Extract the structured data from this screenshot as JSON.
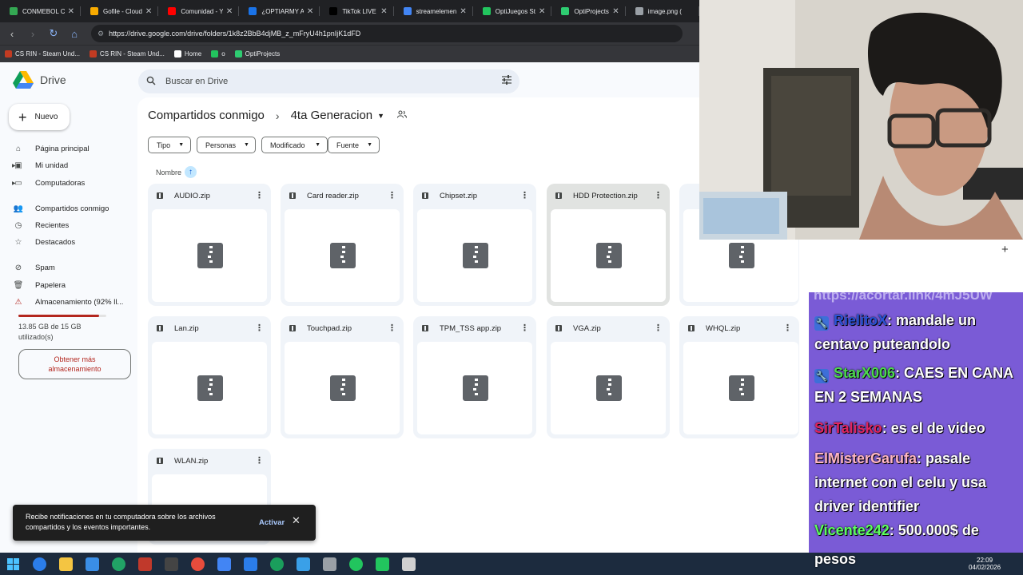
{
  "browser": {
    "tabs": [
      {
        "title": "CONMEBOL C",
        "color": "#34a853"
      },
      {
        "title": "Gofile - Cloud",
        "color": "#f9ab00"
      },
      {
        "title": "Comunidad - Y",
        "color": "#ff0000"
      },
      {
        "title": "¿OPTIARMY A",
        "color": "#1a73e8"
      },
      {
        "title": "TikTok LIVE",
        "color": "#000000"
      },
      {
        "title": "streamelemen",
        "color": "#4285f4"
      },
      {
        "title": "OptiJuegos St",
        "color": "#22c55e"
      },
      {
        "title": "OptiProjects",
        "color": "#2ecc71"
      },
      {
        "title": "image.png (",
        "color": "#9aa0a6"
      }
    ],
    "url": "https://drive.google.com/drive/folders/1k8z2BbB4djMB_z_mFryU4h1pnIjK1dFD",
    "bookmarks": [
      {
        "label": "CS RIN - Steam Und...",
        "color": "#c23b22"
      },
      {
        "label": "CS RIN - Steam Und...",
        "color": "#c23b22"
      },
      {
        "label": "Home",
        "color": "#ffffff"
      },
      {
        "label": "o",
        "color": "#22c55e"
      },
      {
        "label": "OptiProjects",
        "color": "#2ecc71"
      }
    ]
  },
  "drive": {
    "app_name": "Drive",
    "search_placeholder": "Buscar en Drive",
    "new_label": "Nuevo",
    "nav": [
      {
        "label": "Página principal",
        "icon": "home-icon"
      },
      {
        "label": "Mi unidad",
        "icon": "drive-icon"
      },
      {
        "label": "Computadoras",
        "icon": "computer-icon"
      },
      {
        "label": "Compartidos conmigo",
        "icon": "shared-icon"
      },
      {
        "label": "Recientes",
        "icon": "clock-icon"
      },
      {
        "label": "Destacados",
        "icon": "star-icon"
      },
      {
        "label": "Spam",
        "icon": "spam-icon"
      },
      {
        "label": "Papelera",
        "icon": "trash-icon"
      },
      {
        "label": "Almacenamiento (92% ll...",
        "icon": "warning-icon"
      }
    ],
    "storage": {
      "used_text": "13.85 GB de 15 GB utilizado(s)",
      "percent": 92,
      "get_more": "Obtener más almacenamiento"
    },
    "breadcrumb": {
      "parent": "Compartidos conmigo",
      "current": "4ta Generacion"
    },
    "filters": [
      "Tipo",
      "Personas",
      "Modificado",
      "Fuente"
    ],
    "sort_label": "Nombre",
    "files": [
      "AUDIO.zip",
      "Card reader.zip",
      "Chipset.zip",
      "HDD Protection.zip",
      "",
      "Lan.zip",
      "Touchpad.zip",
      "TPM_TSS app.zip",
      "VGA.zip",
      "WHQL.zip",
      "WLAN.zip"
    ],
    "toast": {
      "message": "Recibe notificaciones en tu computadora sobre los archivos compartidos y los eventos importantes.",
      "action": "Activar"
    }
  },
  "chat": {
    "ghost_line": "https://acortar.link/4mJ5UW",
    "messages": [
      {
        "user": "RielitoX",
        "color": "#2a54d6",
        "badge": true,
        "text": ": mandale un centavo puteandolo"
      },
      {
        "user": "StarX006",
        "color": "#4cd94c",
        "badge": true,
        "text": ": CAES EN CANA EN 2 SEMANAS"
      },
      {
        "user": "SirTalisko",
        "color": "#e0245e",
        "badge": false,
        "text": ": es el de video"
      },
      {
        "user": "ElMisterGarufa",
        "color": "#ffb6c1",
        "badge": false,
        "text": ": pasale internet con el celu y usa driver identifier"
      },
      {
        "user": "Vicente242",
        "color": "#5cff5c",
        "badge": false,
        "text": ": 500.000$ de"
      }
    ],
    "last_line": "pesos"
  },
  "taskbar": {
    "icons": [
      "#2b7de9",
      "#f4c542",
      "#3a8ee6",
      "#21a366",
      "#c0392b",
      "#444444",
      "#e74c3c",
      "#4285f4",
      "#2b7de9",
      "#1a9e5c",
      "#3aa0e8",
      "#9aa0a6",
      "#22c55e",
      "#22c55e",
      "#d0d0d0"
    ],
    "time": "22:09",
    "date": "04/02/2026"
  }
}
